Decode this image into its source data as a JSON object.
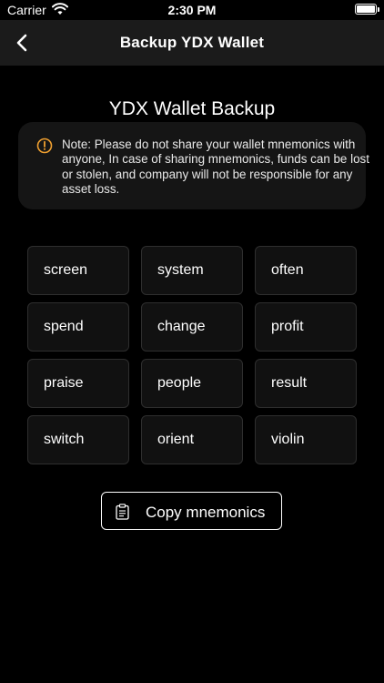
{
  "status_bar": {
    "carrier": "Carrier",
    "time": "2:30 PM"
  },
  "nav": {
    "title": "Backup YDX Wallet",
    "back_icon": "chevron-left-icon"
  },
  "main": {
    "title": "YDX Wallet Backup",
    "note": "Note: Please do not share your wallet mnemonics with anyone, In case of sharing mnemonics, funds can be lost or stolen, and company will not be responsible for any asset loss.",
    "note_icon": "warning-circle-icon",
    "accent_color": "#f0a030",
    "words": [
      "screen",
      "system",
      "often",
      "spend",
      "change",
      "profit",
      "praise",
      "people",
      "result",
      "switch",
      "orient",
      "violin"
    ],
    "copy_button_label": "Copy mnemonics",
    "copy_icon": "clipboard-icon"
  }
}
